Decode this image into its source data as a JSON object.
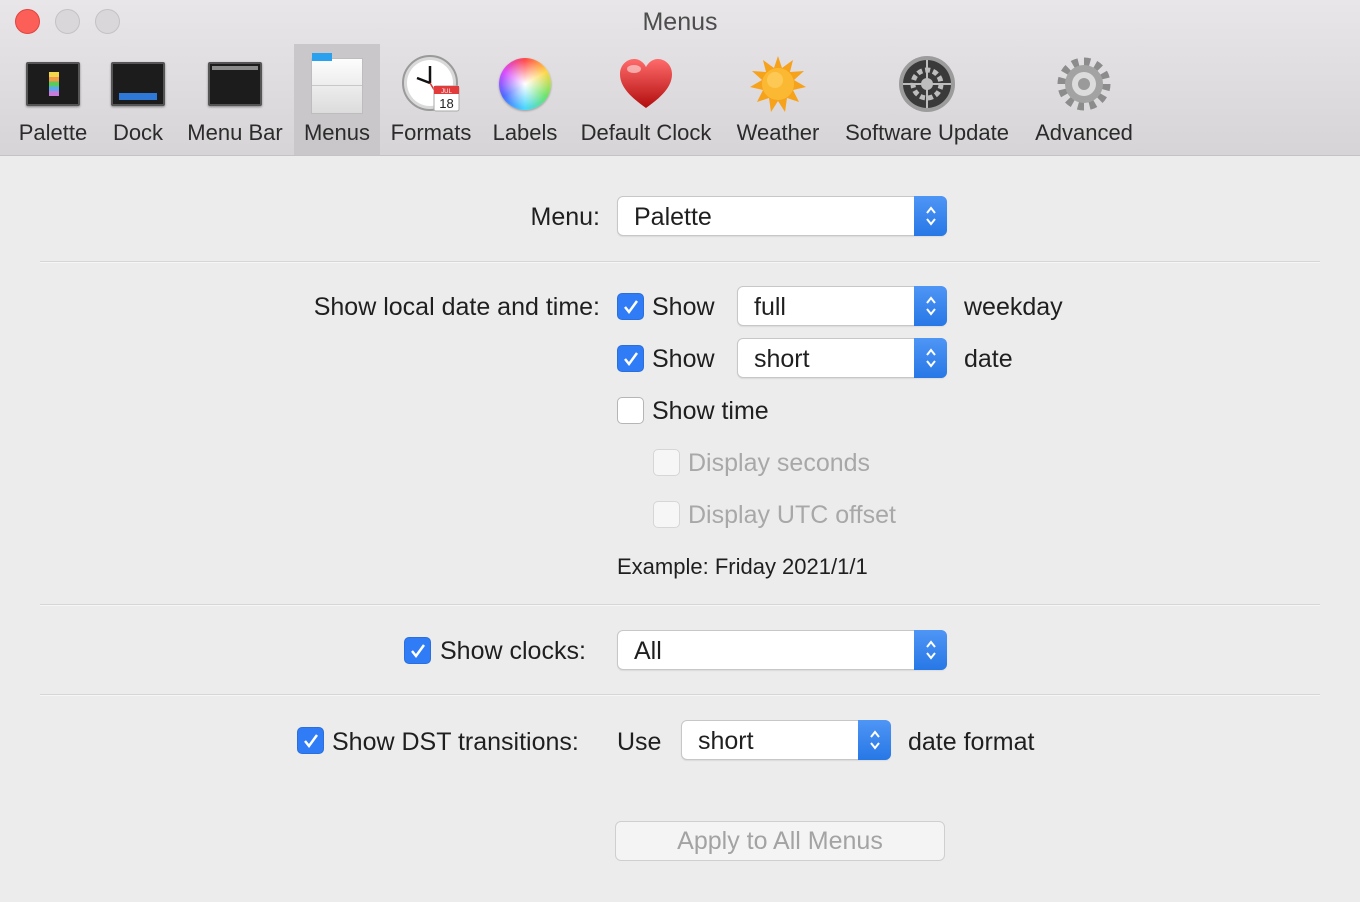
{
  "window": {
    "title": "Menus"
  },
  "toolbar": {
    "items": [
      {
        "label": "Palette",
        "icon": "palette-icon"
      },
      {
        "label": "Dock",
        "icon": "dock-icon"
      },
      {
        "label": "Menu Bar",
        "icon": "menu-bar-icon"
      },
      {
        "label": "Menus",
        "icon": "menus-icon",
        "selected": true
      },
      {
        "label": "Formats",
        "icon": "clock-calendar-icon"
      },
      {
        "label": "Labels",
        "icon": "color-wheel-icon"
      },
      {
        "label": "Default Clock",
        "icon": "heart-icon"
      },
      {
        "label": "Weather",
        "icon": "sun-icon"
      },
      {
        "label": "Software Update",
        "icon": "software-update-icon"
      },
      {
        "label": "Advanced",
        "icon": "gear-icon"
      }
    ],
    "calendar_month": "JUL",
    "calendar_day": "18"
  },
  "menu_row": {
    "label": "Menu:",
    "value": "Palette"
  },
  "local": {
    "label": "Show local date and time:",
    "weekday": {
      "checked": true,
      "show_label": "Show",
      "value": "full",
      "suffix": "weekday"
    },
    "date": {
      "checked": true,
      "show_label": "Show",
      "value": "short",
      "suffix": "date"
    },
    "time": {
      "checked": false,
      "label": "Show time"
    },
    "seconds": {
      "checked": false,
      "enabled": false,
      "label": "Display seconds"
    },
    "utc": {
      "checked": false,
      "enabled": false,
      "label": "Display UTC offset"
    },
    "example": "Example: Friday 2021/1/1"
  },
  "clocks": {
    "checked": true,
    "label": "Show clocks:",
    "value": "All"
  },
  "dst": {
    "checked": true,
    "label": "Show DST transitions:",
    "use_label": "Use",
    "value": "short",
    "suffix": "date format"
  },
  "apply_button": {
    "label": "Apply to All Menus",
    "enabled": false
  },
  "colors": {
    "accent": "#2f7cf6",
    "close": "#fc5f57",
    "toolbar_selected": "#c9c7c9"
  }
}
